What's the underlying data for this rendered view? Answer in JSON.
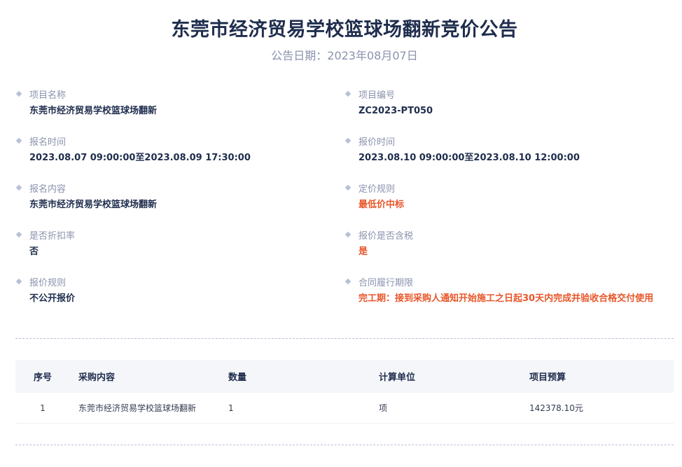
{
  "header": {
    "title": "东莞市经济贸易学校篮球场翻新竞价公告",
    "date": "公告日期：2023年08月07日"
  },
  "info": {
    "project_name_label": "项目名称",
    "project_name": "东莞市经济贸易学校篮球场翻新",
    "project_no_label": "项目编号",
    "project_no": "ZC2023-PT050",
    "signup_time_label": "报名时间",
    "signup_time": "2023.08.07 09:00:00至2023.08.09 17:30:00",
    "quote_time_label": "报价时间",
    "quote_time": "2023.08.10 09:00:00至2023.08.10 12:00:00",
    "signup_content_label": "报名内容",
    "signup_content": "东莞市经济贸易学校篮球场翻新",
    "pricing_rule_label": "定价规则",
    "pricing_rule": "最低价中标",
    "discount_label": "是否折扣率",
    "discount": "否",
    "tax_label": "报价是否含税",
    "tax": "是",
    "quote_rule_label": "报价规则",
    "quote_rule": "不公开报价",
    "contract_period_label": "合同履行期限",
    "contract_period": "完工期：接到采购人通知开始施工之日起30天内完成并验收合格交付使用"
  },
  "table": {
    "headers": [
      "序号",
      "采购内容",
      "数量",
      "计算单位",
      "项目预算"
    ],
    "rows": [
      [
        "1",
        "东莞市经济贸易学校篮球场翻新",
        "1",
        "项",
        "142378.10元"
      ]
    ]
  },
  "colors": {
    "primary_text": "#1f2d4d",
    "muted_text": "#8a93ad",
    "accent": "#e8562a"
  }
}
